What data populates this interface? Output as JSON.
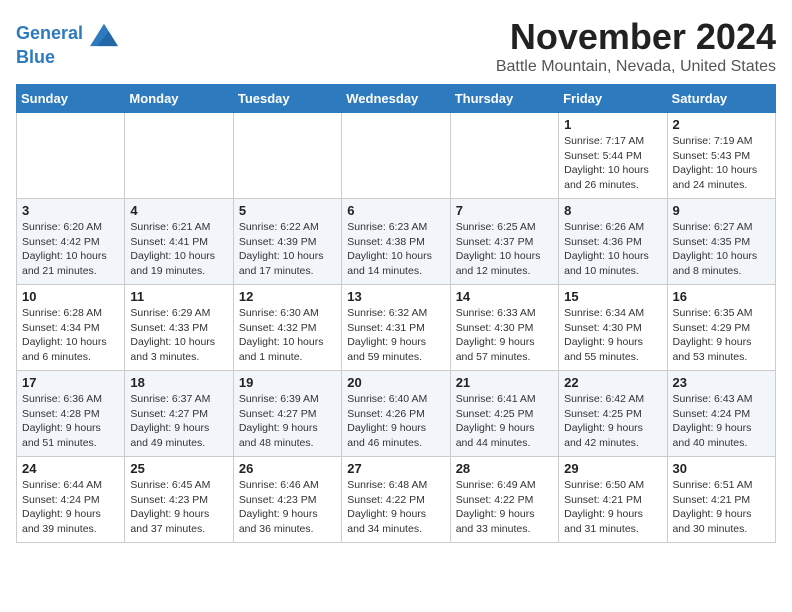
{
  "header": {
    "logo_line1": "General",
    "logo_line2": "Blue",
    "month_title": "November 2024",
    "location": "Battle Mountain, Nevada, United States"
  },
  "weekdays": [
    "Sunday",
    "Monday",
    "Tuesday",
    "Wednesday",
    "Thursday",
    "Friday",
    "Saturday"
  ],
  "weeks": [
    [
      {
        "day": "",
        "info": ""
      },
      {
        "day": "",
        "info": ""
      },
      {
        "day": "",
        "info": ""
      },
      {
        "day": "",
        "info": ""
      },
      {
        "day": "",
        "info": ""
      },
      {
        "day": "1",
        "info": "Sunrise: 7:17 AM\nSunset: 5:44 PM\nDaylight: 10 hours and 26 minutes."
      },
      {
        "day": "2",
        "info": "Sunrise: 7:19 AM\nSunset: 5:43 PM\nDaylight: 10 hours and 24 minutes."
      }
    ],
    [
      {
        "day": "3",
        "info": "Sunrise: 6:20 AM\nSunset: 4:42 PM\nDaylight: 10 hours and 21 minutes."
      },
      {
        "day": "4",
        "info": "Sunrise: 6:21 AM\nSunset: 4:41 PM\nDaylight: 10 hours and 19 minutes."
      },
      {
        "day": "5",
        "info": "Sunrise: 6:22 AM\nSunset: 4:39 PM\nDaylight: 10 hours and 17 minutes."
      },
      {
        "day": "6",
        "info": "Sunrise: 6:23 AM\nSunset: 4:38 PM\nDaylight: 10 hours and 14 minutes."
      },
      {
        "day": "7",
        "info": "Sunrise: 6:25 AM\nSunset: 4:37 PM\nDaylight: 10 hours and 12 minutes."
      },
      {
        "day": "8",
        "info": "Sunrise: 6:26 AM\nSunset: 4:36 PM\nDaylight: 10 hours and 10 minutes."
      },
      {
        "day": "9",
        "info": "Sunrise: 6:27 AM\nSunset: 4:35 PM\nDaylight: 10 hours and 8 minutes."
      }
    ],
    [
      {
        "day": "10",
        "info": "Sunrise: 6:28 AM\nSunset: 4:34 PM\nDaylight: 10 hours and 6 minutes."
      },
      {
        "day": "11",
        "info": "Sunrise: 6:29 AM\nSunset: 4:33 PM\nDaylight: 10 hours and 3 minutes."
      },
      {
        "day": "12",
        "info": "Sunrise: 6:30 AM\nSunset: 4:32 PM\nDaylight: 10 hours and 1 minute."
      },
      {
        "day": "13",
        "info": "Sunrise: 6:32 AM\nSunset: 4:31 PM\nDaylight: 9 hours and 59 minutes."
      },
      {
        "day": "14",
        "info": "Sunrise: 6:33 AM\nSunset: 4:30 PM\nDaylight: 9 hours and 57 minutes."
      },
      {
        "day": "15",
        "info": "Sunrise: 6:34 AM\nSunset: 4:30 PM\nDaylight: 9 hours and 55 minutes."
      },
      {
        "day": "16",
        "info": "Sunrise: 6:35 AM\nSunset: 4:29 PM\nDaylight: 9 hours and 53 minutes."
      }
    ],
    [
      {
        "day": "17",
        "info": "Sunrise: 6:36 AM\nSunset: 4:28 PM\nDaylight: 9 hours and 51 minutes."
      },
      {
        "day": "18",
        "info": "Sunrise: 6:37 AM\nSunset: 4:27 PM\nDaylight: 9 hours and 49 minutes."
      },
      {
        "day": "19",
        "info": "Sunrise: 6:39 AM\nSunset: 4:27 PM\nDaylight: 9 hours and 48 minutes."
      },
      {
        "day": "20",
        "info": "Sunrise: 6:40 AM\nSunset: 4:26 PM\nDaylight: 9 hours and 46 minutes."
      },
      {
        "day": "21",
        "info": "Sunrise: 6:41 AM\nSunset: 4:25 PM\nDaylight: 9 hours and 44 minutes."
      },
      {
        "day": "22",
        "info": "Sunrise: 6:42 AM\nSunset: 4:25 PM\nDaylight: 9 hours and 42 minutes."
      },
      {
        "day": "23",
        "info": "Sunrise: 6:43 AM\nSunset: 4:24 PM\nDaylight: 9 hours and 40 minutes."
      }
    ],
    [
      {
        "day": "24",
        "info": "Sunrise: 6:44 AM\nSunset: 4:24 PM\nDaylight: 9 hours and 39 minutes."
      },
      {
        "day": "25",
        "info": "Sunrise: 6:45 AM\nSunset: 4:23 PM\nDaylight: 9 hours and 37 minutes."
      },
      {
        "day": "26",
        "info": "Sunrise: 6:46 AM\nSunset: 4:23 PM\nDaylight: 9 hours and 36 minutes."
      },
      {
        "day": "27",
        "info": "Sunrise: 6:48 AM\nSunset: 4:22 PM\nDaylight: 9 hours and 34 minutes."
      },
      {
        "day": "28",
        "info": "Sunrise: 6:49 AM\nSunset: 4:22 PM\nDaylight: 9 hours and 33 minutes."
      },
      {
        "day": "29",
        "info": "Sunrise: 6:50 AM\nSunset: 4:21 PM\nDaylight: 9 hours and 31 minutes."
      },
      {
        "day": "30",
        "info": "Sunrise: 6:51 AM\nSunset: 4:21 PM\nDaylight: 9 hours and 30 minutes."
      }
    ]
  ]
}
